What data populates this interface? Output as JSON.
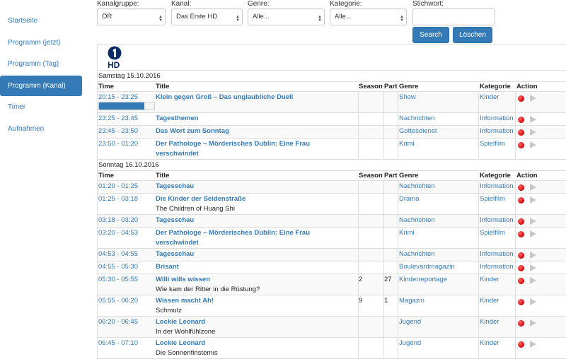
{
  "sidebar": {
    "items": [
      {
        "label": "Startseite",
        "active": false
      },
      {
        "label": "Programm (jetzt)",
        "active": false
      },
      {
        "label": "Programm (Tag)",
        "active": false
      },
      {
        "label": "Programm (Kanal)",
        "active": true
      },
      {
        "label": "Timer",
        "active": false
      },
      {
        "label": "Aufnahmen",
        "active": false
      }
    ]
  },
  "filters": {
    "kanalgruppe": {
      "label": "Kanalgruppe:",
      "value": "ÖR"
    },
    "kanal": {
      "label": "Kanal:",
      "value": "Das Erste HD"
    },
    "genre": {
      "label": "Genre:",
      "value": "Alle..."
    },
    "kategorie": {
      "label": "Kategorie:",
      "value": "Alle..."
    },
    "stichwort": {
      "label": "Stichwort:",
      "value": ""
    },
    "search_label": "Search",
    "clear_label": "Löschen"
  },
  "channel_logo": {
    "icon": "das-erste-hd-logo",
    "text": "HD"
  },
  "columns": {
    "time": "Time",
    "title": "Title",
    "season": "Season",
    "part": "Part",
    "genre": "Genre",
    "kategorie": "Kategorie",
    "action": "Action"
  },
  "colors": {
    "accent": "#337ab7",
    "record": "#e00000",
    "play": "#c8c8c8"
  },
  "days": [
    {
      "date": "Samstag 15.10.2016",
      "rows": [
        {
          "time": "20:15 - 23:25",
          "title": "Klein gegen Groß – Das unglaubliche Duell",
          "subtitle": "",
          "season": "",
          "part": "",
          "genre": "Show",
          "kategorie": "Kinder",
          "progress": 0.82
        },
        {
          "time": "23:25 - 23:45",
          "title": "Tagesthemen",
          "subtitle": "",
          "season": "",
          "part": "",
          "genre": "Nachrichten",
          "kategorie": "Information"
        },
        {
          "time": "23:45 - 23:50",
          "title": "Das Wort zum Sonntag",
          "subtitle": "",
          "season": "",
          "part": "",
          "genre": "Gottesdienst",
          "kategorie": "Information"
        },
        {
          "time": "23:50 - 01:20",
          "title": "Der Pathologe – Mörderisches Dublin: Eine Frau verschwindet",
          "subtitle": "",
          "season": "",
          "part": "",
          "genre": "Krimi",
          "kategorie": "Spielfilm"
        }
      ]
    },
    {
      "date": "Sonntag 16.10.2016",
      "rows": [
        {
          "time": "01:20 - 01:25",
          "title": "Tagesschau",
          "subtitle": "",
          "season": "",
          "part": "",
          "genre": "Nachrichten",
          "kategorie": "Information"
        },
        {
          "time": "01:25 - 03:18",
          "title": "Die Kinder der Seidenstraße",
          "subtitle": "The Children of Huang Shi",
          "season": "",
          "part": "",
          "genre": "Drama",
          "kategorie": "Spielfilm"
        },
        {
          "time": "03:18 - 03:20",
          "title": "Tagesschau",
          "subtitle": "",
          "season": "",
          "part": "",
          "genre": "Nachrichten",
          "kategorie": "Information"
        },
        {
          "time": "03:20 - 04:53",
          "title": "Der Pathologe – Mörderisches Dublin: Eine Frau verschwindet",
          "subtitle": "",
          "season": "",
          "part": "",
          "genre": "Krimi",
          "kategorie": "Spielfilm"
        },
        {
          "time": "04:53 - 04:55",
          "title": "Tagesschau",
          "subtitle": "",
          "season": "",
          "part": "",
          "genre": "Nachrichten",
          "kategorie": "Information"
        },
        {
          "time": "04:55 - 05:30",
          "title": "Brisant",
          "subtitle": "",
          "season": "",
          "part": "",
          "genre": "Boulevardmagazin",
          "kategorie": "Information"
        },
        {
          "time": "05:30 - 05:55",
          "title": "Willi wills wissen",
          "subtitle": "Wie kam der Ritter in die Rüstung?",
          "season": "2",
          "part": "27",
          "genre": "Kinderreportage",
          "kategorie": "Kinder"
        },
        {
          "time": "05:55 - 06:20",
          "title": "Wissen macht Ah!",
          "subtitle": "Schmutz",
          "season": "9",
          "part": "1",
          "genre": "Magazin",
          "kategorie": "Kinder"
        },
        {
          "time": "06:20 - 06:45",
          "title": "Lockie Leonard",
          "subtitle": "In der Wohlfühlzone",
          "season": "",
          "part": "",
          "genre": "Jugend",
          "kategorie": "Kinder"
        },
        {
          "time": "06:45 - 07:10",
          "title": "Lockie Leonard",
          "subtitle": "Die Sonnenfinsternis",
          "season": "",
          "part": "",
          "genre": "Jugend",
          "kategorie": "Kinder"
        }
      ]
    }
  ]
}
